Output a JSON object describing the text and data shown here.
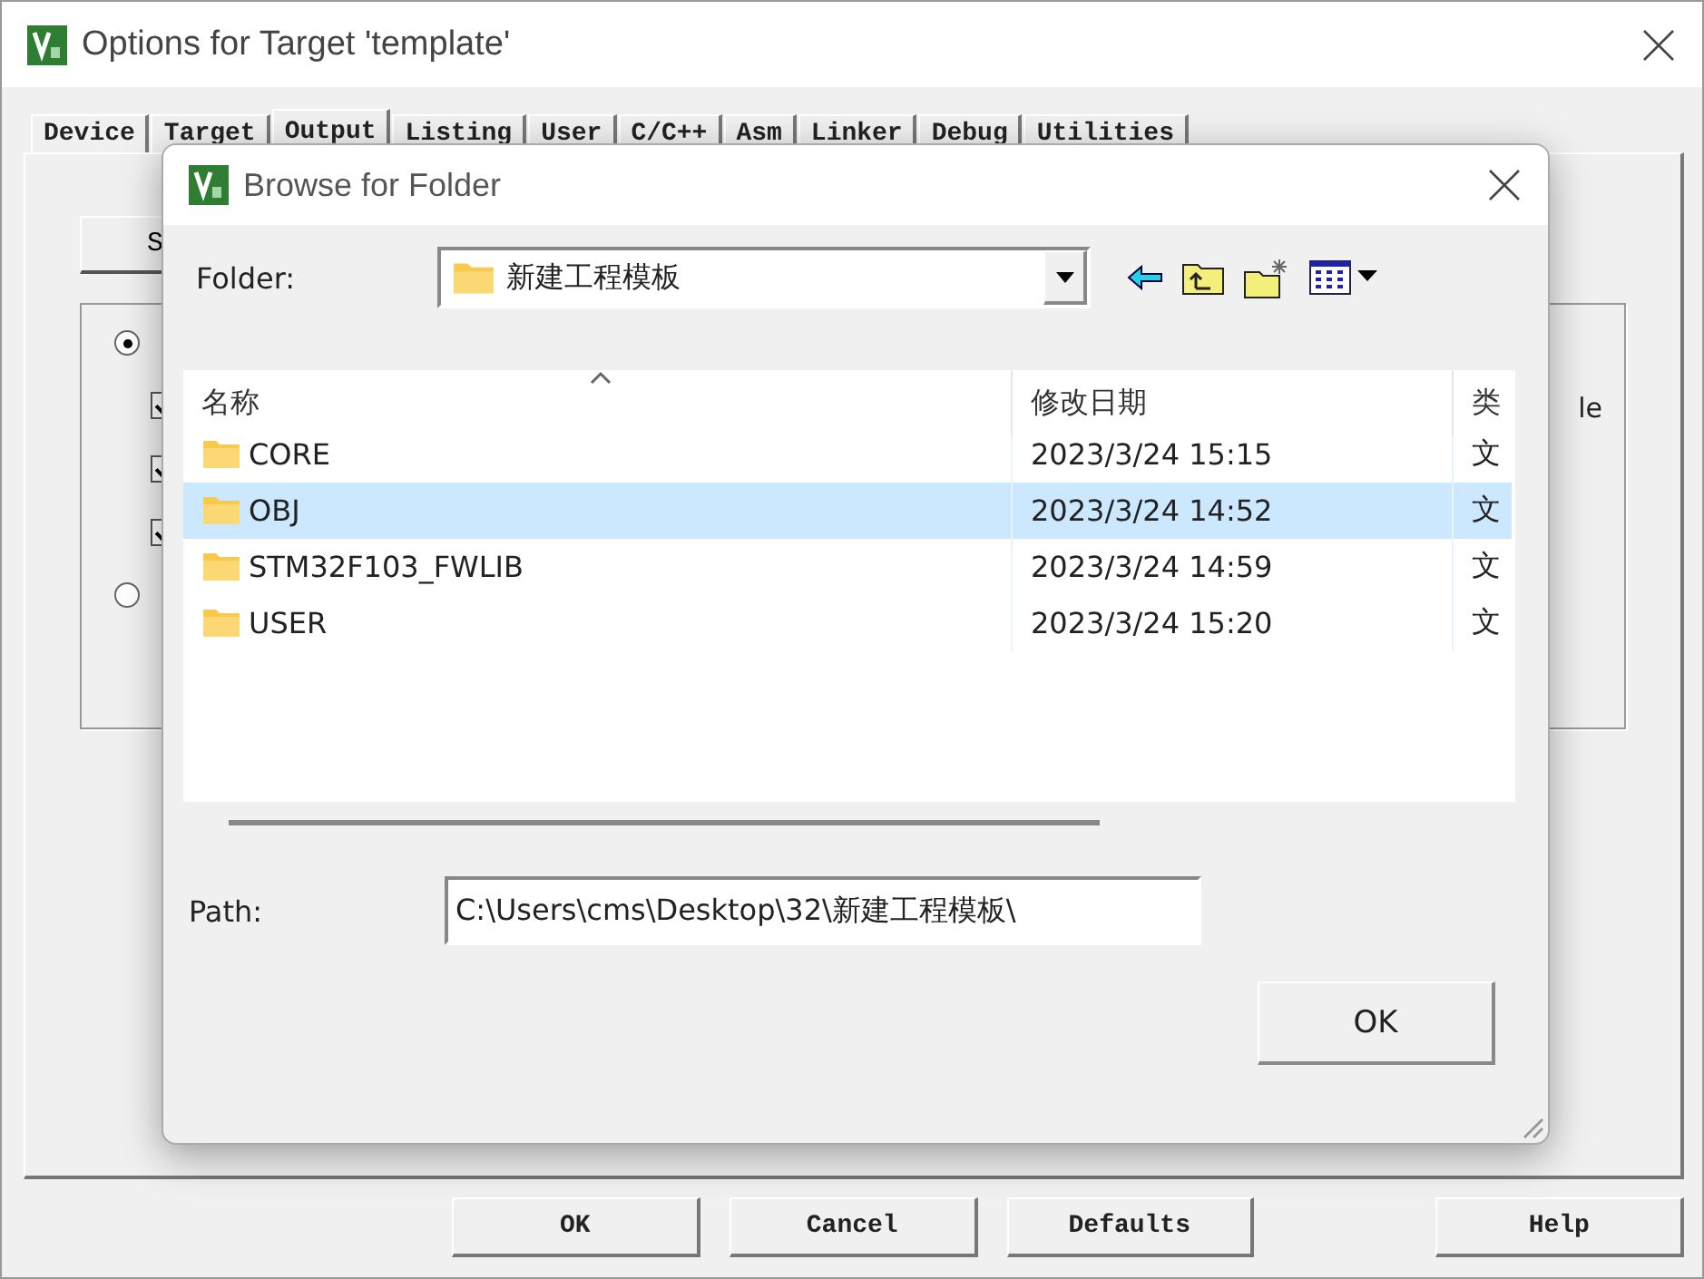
{
  "window": {
    "title": "Options for Target 'template'"
  },
  "tabs": [
    {
      "label": "Device",
      "selected": false
    },
    {
      "label": "Target",
      "selected": false
    },
    {
      "label": "Output",
      "selected": true
    },
    {
      "label": "Listing",
      "selected": false
    },
    {
      "label": "User",
      "selected": false
    },
    {
      "label": "C/C++",
      "selected": false
    },
    {
      "label": "Asm",
      "selected": false
    },
    {
      "label": "Linker",
      "selected": false
    },
    {
      "label": "Debug",
      "selected": false
    },
    {
      "label": "Utilities",
      "selected": false
    }
  ],
  "panel": {
    "button_label": "S",
    "side_text": "le",
    "options": [
      {
        "kind": "radio",
        "selected": true
      },
      {
        "kind": "checkbox",
        "checked": true
      },
      {
        "kind": "checkbox",
        "checked": true
      },
      {
        "kind": "checkbox",
        "checked": true
      },
      {
        "kind": "radio",
        "selected": false
      }
    ]
  },
  "dialog": {
    "title": "Browse for Folder",
    "folder_label": "Folder:",
    "folder_value": "新建工程模板",
    "columns": [
      "名称",
      "修改日期",
      "类"
    ],
    "rows": [
      {
        "name": "CORE",
        "date": "2023/3/24 15:15",
        "type": "文",
        "selected": false
      },
      {
        "name": "OBJ",
        "date": "2023/3/24 14:52",
        "type": "文",
        "selected": true
      },
      {
        "name": "STM32F103_FWLIB",
        "date": "2023/3/24 14:59",
        "type": "文",
        "selected": false
      },
      {
        "name": "USER",
        "date": "2023/3/24 15:20",
        "type": "文",
        "selected": false
      }
    ],
    "path_label": "Path:",
    "path_value": "C:\\Users\\cms\\Desktop\\32\\新建工程模板\\",
    "ok_label": "OK"
  },
  "buttons": [
    "OK",
    "Cancel",
    "Defaults",
    "Help"
  ]
}
